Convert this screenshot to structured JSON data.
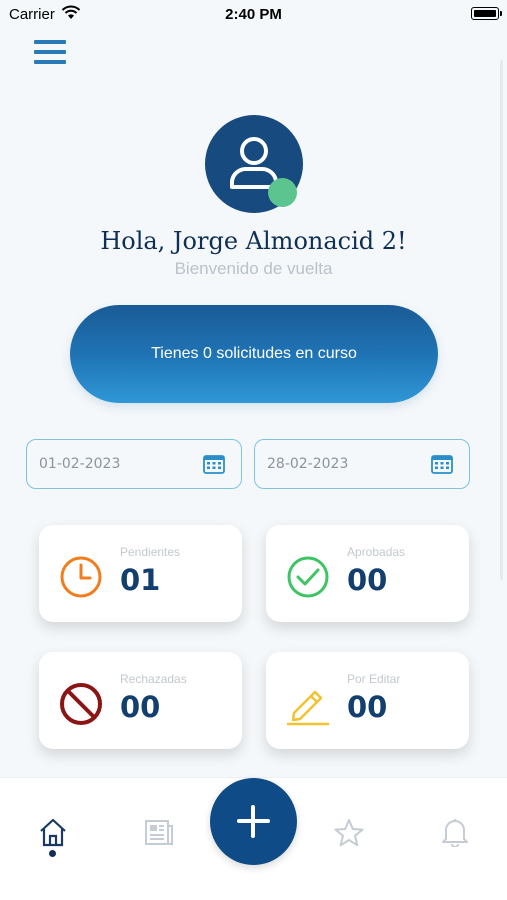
{
  "status_bar": {
    "carrier": "Carrier",
    "time": "2:40 PM"
  },
  "user": {
    "greeting": "Hola, Jorge Almonacid   2!",
    "subtitle": "Bienvenido de vuelta",
    "online": true
  },
  "requests_banner": {
    "text": "Tienes 0 solicitudes en curso"
  },
  "date_range": {
    "start": "01-02-2023",
    "end": "28-02-2023"
  },
  "stats": {
    "pending": {
      "label": "Pendientes",
      "count": "01",
      "icon": "clock-icon",
      "color": "#f07e1e"
    },
    "approved": {
      "label": "Aprobadas",
      "count": "00",
      "icon": "check-circle-icon",
      "color": "#3ec463"
    },
    "rejected": {
      "label": "Rechazadas",
      "count": "00",
      "icon": "prohibited-icon",
      "color": "#8b1414"
    },
    "to_edit": {
      "label": "Por Editar",
      "count": "00",
      "icon": "pencil-icon",
      "color": "#f2c230"
    }
  },
  "bottom_nav": {
    "items": [
      {
        "name": "home",
        "icon": "home-icon",
        "active": true
      },
      {
        "name": "news",
        "icon": "newspaper-icon",
        "active": false
      },
      {
        "name": "add",
        "icon": "plus-icon",
        "active": false
      },
      {
        "name": "favorites",
        "icon": "star-icon",
        "active": false
      },
      {
        "name": "notifications",
        "icon": "bell-icon",
        "active": false
      }
    ]
  },
  "colors": {
    "primary": "#0f4b86",
    "accent": "#2a7ab7",
    "background": "#f5f8fa",
    "online": "#5cc48e"
  }
}
